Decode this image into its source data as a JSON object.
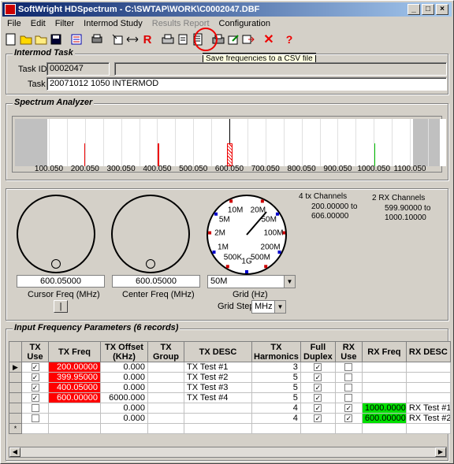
{
  "window": {
    "title": "SoftWright HDSpectrum - C:\\SWTAP\\WORK\\C0002047.DBF",
    "min": "_",
    "max": "□",
    "close": "×"
  },
  "menu": [
    "File",
    "Edit",
    "Filter",
    "Intermod Study",
    "Results Report",
    "Configuration"
  ],
  "menu_disabled": [
    "Results Report"
  ],
  "toolbar_icons": [
    "new-icon",
    "open-icon",
    "folder-icon",
    "save-icon",
    "list-icon",
    "print-preview-icon",
    "import-icon",
    "swap-icon",
    "r-icon",
    "print-icon",
    "report-icon",
    "csv-icon",
    "printer-icon",
    "edit-icon",
    "export-icon",
    "delete-icon",
    "help-icon"
  ],
  "tooltip": "Save frequencies to a CSV file",
  "intermod": {
    "group_title": "Intermod Task",
    "task_id_label": "Task ID:",
    "task_id": "0002047",
    "task_label": "Task",
    "task": "20071012 1050 INTERMOD"
  },
  "spectrum": {
    "group_title": "Spectrum Analyzer",
    "ticks": [
      "100.050",
      "200.050",
      "300.050",
      "400.050",
      "500.050",
      "600.050",
      "700.050",
      "800.050",
      "900.050",
      "1000.050",
      "1100.050"
    ]
  },
  "controls": {
    "cursor_freq": "600.05000",
    "cursor_label": "Cursor Freq (MHz)",
    "center_freq": "600.05000",
    "center_label": "Center Freq (MHz)",
    "grid_value": "50M",
    "grid_label": "Grid (Hz)",
    "grid_step_label": "Grid Step",
    "grid_step": "MHz",
    "dial_labels": [
      "20M",
      "50M",
      "100M",
      "200M",
      "500M",
      "1G",
      "500K",
      "1M",
      "2M",
      "5M",
      "10M"
    ],
    "tx_channels": "4 tx Channels",
    "tx_range": "200.00000 to\n606.00000",
    "rx_channels": "2 RX Channels",
    "rx_range": "599.90000 to\n1000.10000",
    "toggle_button": "|"
  },
  "input": {
    "group_title": "Input Frequency Parameters (6 records)",
    "headers": [
      "TX\nUse",
      "TX Freq",
      "TX Offset\n(KHz)",
      "TX\nGroup",
      "TX DESC",
      "TX\nHarmonics",
      "Full\nDuplex",
      "RX\nUse",
      "RX Freq",
      "RX DESC"
    ],
    "rows": [
      {
        "tx_use": true,
        "tx_freq": "200.00000",
        "offset": "0.000",
        "group": "",
        "desc": "TX Test #1",
        "harm": "3",
        "duplex": true,
        "rx_use": false,
        "rx_freq": "",
        "rx_desc": ""
      },
      {
        "tx_use": true,
        "tx_freq": "399.95000",
        "offset": "0.000",
        "group": "",
        "desc": "TX Test #2",
        "harm": "5",
        "duplex": true,
        "rx_use": false,
        "rx_freq": "",
        "rx_desc": ""
      },
      {
        "tx_use": true,
        "tx_freq": "400.05000",
        "offset": "0.000",
        "group": "",
        "desc": "TX Test #3",
        "harm": "5",
        "duplex": true,
        "rx_use": false,
        "rx_freq": "",
        "rx_desc": ""
      },
      {
        "tx_use": true,
        "tx_freq": "600.00000",
        "offset": "6000.000",
        "group": "",
        "desc": "TX Test #4",
        "harm": "5",
        "duplex": true,
        "rx_use": false,
        "rx_freq": "",
        "rx_desc": ""
      },
      {
        "tx_use": false,
        "tx_freq": "",
        "offset": "0.000",
        "group": "",
        "desc": "",
        "harm": "4",
        "duplex": true,
        "rx_use": true,
        "rx_freq": "1000.00000",
        "rx_desc": "RX Test #1"
      },
      {
        "tx_use": false,
        "tx_freq": "",
        "offset": "0.000",
        "group": "",
        "desc": "",
        "harm": "4",
        "duplex": true,
        "rx_use": true,
        "rx_freq": "600.00000",
        "rx_desc": "RX Test #2"
      }
    ],
    "new_row_marker": "*",
    "current_row_marker": "▶"
  },
  "colors": {
    "tx_highlight": "#ff0000",
    "rx_highlight": "#00e000",
    "title_start": "#0a246a"
  }
}
